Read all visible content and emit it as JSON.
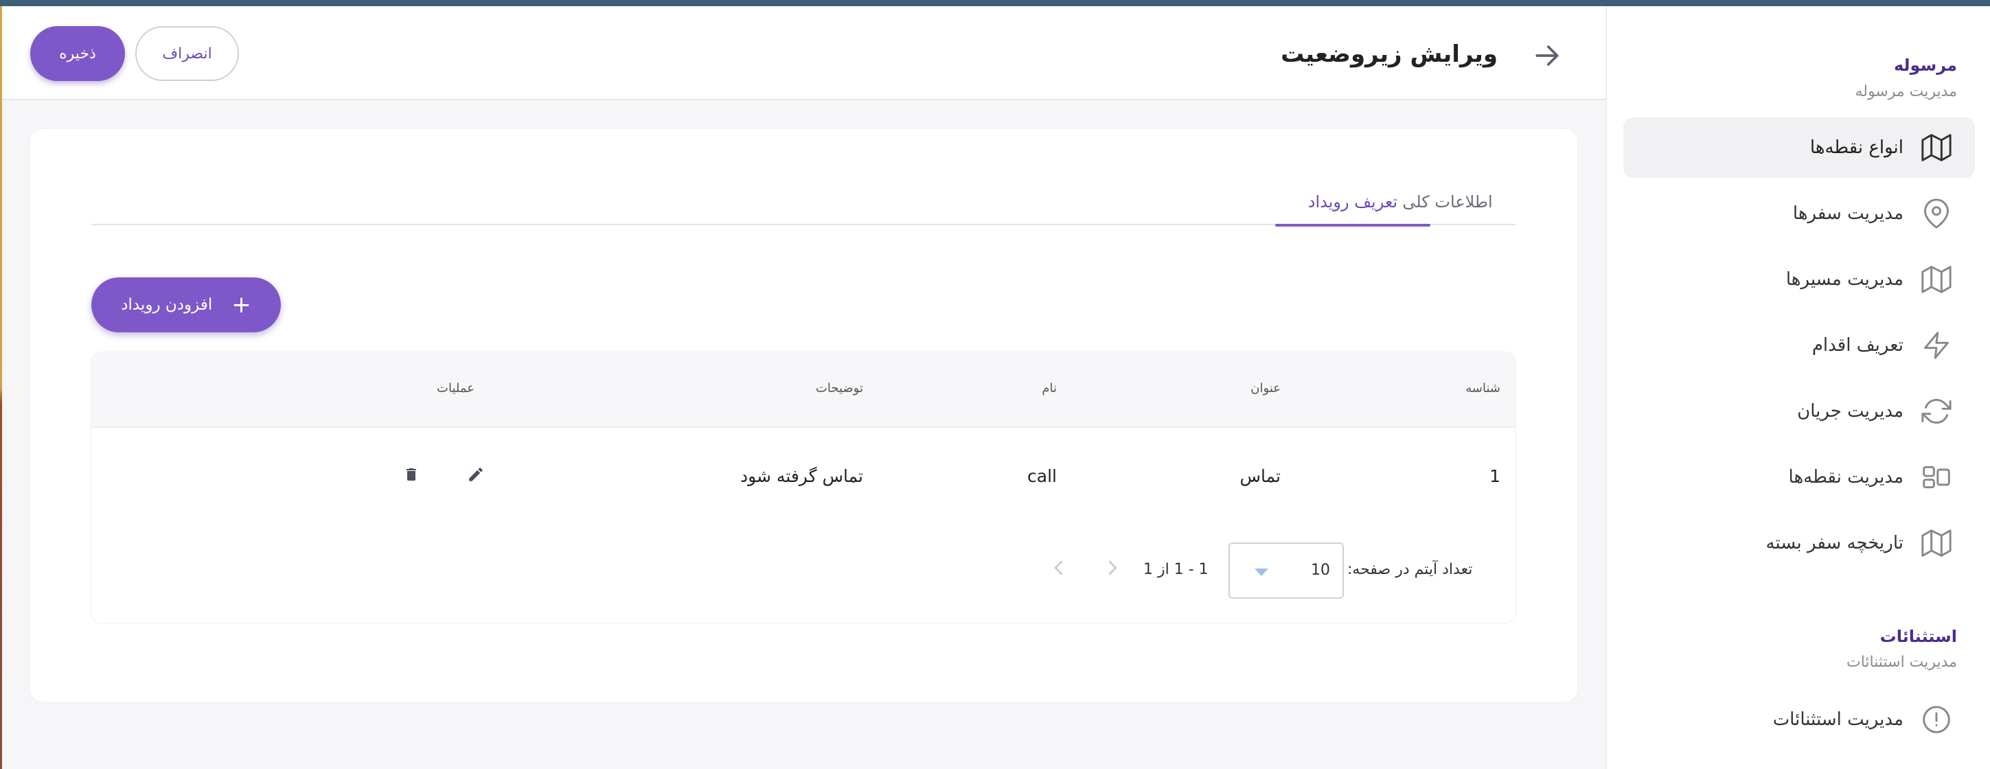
{
  "header": {
    "title": "ویرایش زیروضعیت",
    "save_label": "ذخیره",
    "cancel_label": "انصراف"
  },
  "tabs": [
    {
      "label": "اطلاعات کلی",
      "active": false
    },
    {
      "label": "تعریف رویداد",
      "active": true
    }
  ],
  "add_button_label": "افزودن رویداد",
  "table": {
    "columns": [
      "شناسه",
      "عنوان",
      "نام",
      "توضیحات",
      "عملیات"
    ],
    "rows": [
      {
        "id": "1",
        "title": "تماس",
        "name": "call",
        "description": "تماس گرفته شود"
      }
    ]
  },
  "pagination": {
    "items_per_page_label": "تعداد آیتم در صفحه:",
    "items_per_page": "10",
    "range": "1 - 1 از 1"
  },
  "sidebar": {
    "sections": [
      {
        "title": "مرسوله",
        "subtitle": "مدیریت مرسوله",
        "items": [
          {
            "label": "انواع نقطه‌ها",
            "icon": "map-icon",
            "active": true
          },
          {
            "label": "مدیریت سفرها",
            "icon": "location-pin-icon",
            "active": false
          },
          {
            "label": "مدیریت مسیرها",
            "icon": "map-icon",
            "active": false
          },
          {
            "label": "تعریف اقدام",
            "icon": "lightning-icon",
            "active": false
          },
          {
            "label": "مدیریت جریان",
            "icon": "refresh-icon",
            "active": false
          },
          {
            "label": "مدیریت نقطه‌ها",
            "icon": "layout-icon",
            "active": false
          },
          {
            "label": "تاریخچه سفر بسته",
            "icon": "map-icon",
            "active": false
          }
        ]
      },
      {
        "title": "استثنائات",
        "subtitle": "مدیریت استثنائات",
        "items": [
          {
            "label": "مدیریت استثنائات",
            "icon": "alert-circle-icon",
            "active": false
          }
        ]
      }
    ]
  },
  "colors": {
    "primary": "#7e58c8",
    "top_bar": "#3c6078",
    "section_title": "#4b2c8f"
  }
}
